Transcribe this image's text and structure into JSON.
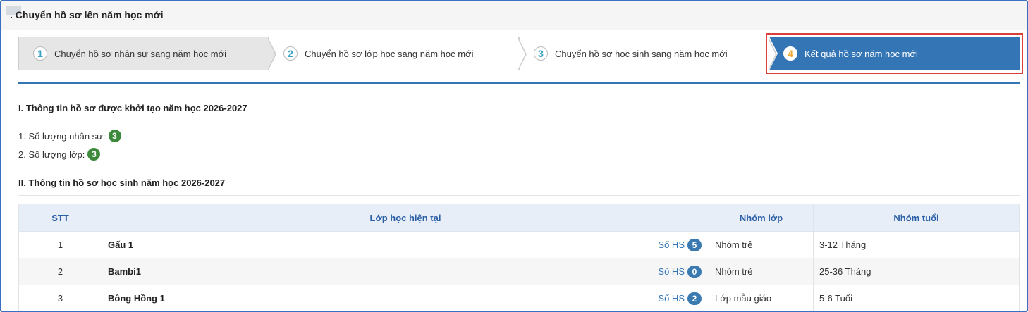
{
  "header": {
    "title": ". Chuyển hồ sơ lên năm học mới"
  },
  "steps": [
    {
      "num": "1",
      "label": "Chuyển hồ sơ nhân sự sang năm học mới"
    },
    {
      "num": "2",
      "label": "Chuyển hồ sơ lớp học sang năm học mới"
    },
    {
      "num": "3",
      "label": "Chuyển hồ sơ học sinh sang năm học mới"
    },
    {
      "num": "4",
      "label": "Kết quả hồ sơ năm học mới"
    }
  ],
  "section1": {
    "title": "I. Thông tin hồ sơ được khởi tạo năm học 2026-2027",
    "staff_label": "1. Số lượng nhân sự:",
    "staff_count": "3",
    "class_label": "2. Số lượng lớp:",
    "class_count": "3"
  },
  "section2": {
    "title": "II. Thông tin hồ sơ học sinh năm học 2026-2027",
    "columns": [
      "STT",
      "Lớp học hiện tại",
      "Nhóm lớp",
      "Nhóm tuổi"
    ],
    "sohs_label": "Số HS",
    "rows": [
      {
        "stt": "1",
        "class": "Gấu 1",
        "students": "5",
        "group": "Nhóm trẻ",
        "age": "3-12 Tháng"
      },
      {
        "stt": "2",
        "class": "Bambi1",
        "students": "0",
        "group": "Nhóm trẻ",
        "age": "25-36 Tháng"
      },
      {
        "stt": "3",
        "class": "Bông Hồng 1",
        "students": "2",
        "group": "Lớp mẫu giáo",
        "age": "5-6 Tuổi"
      }
    ]
  },
  "colors": {
    "accent": "#3375b5",
    "highlight_border": "#d9403a",
    "badge_green": "#3d8a3d"
  }
}
